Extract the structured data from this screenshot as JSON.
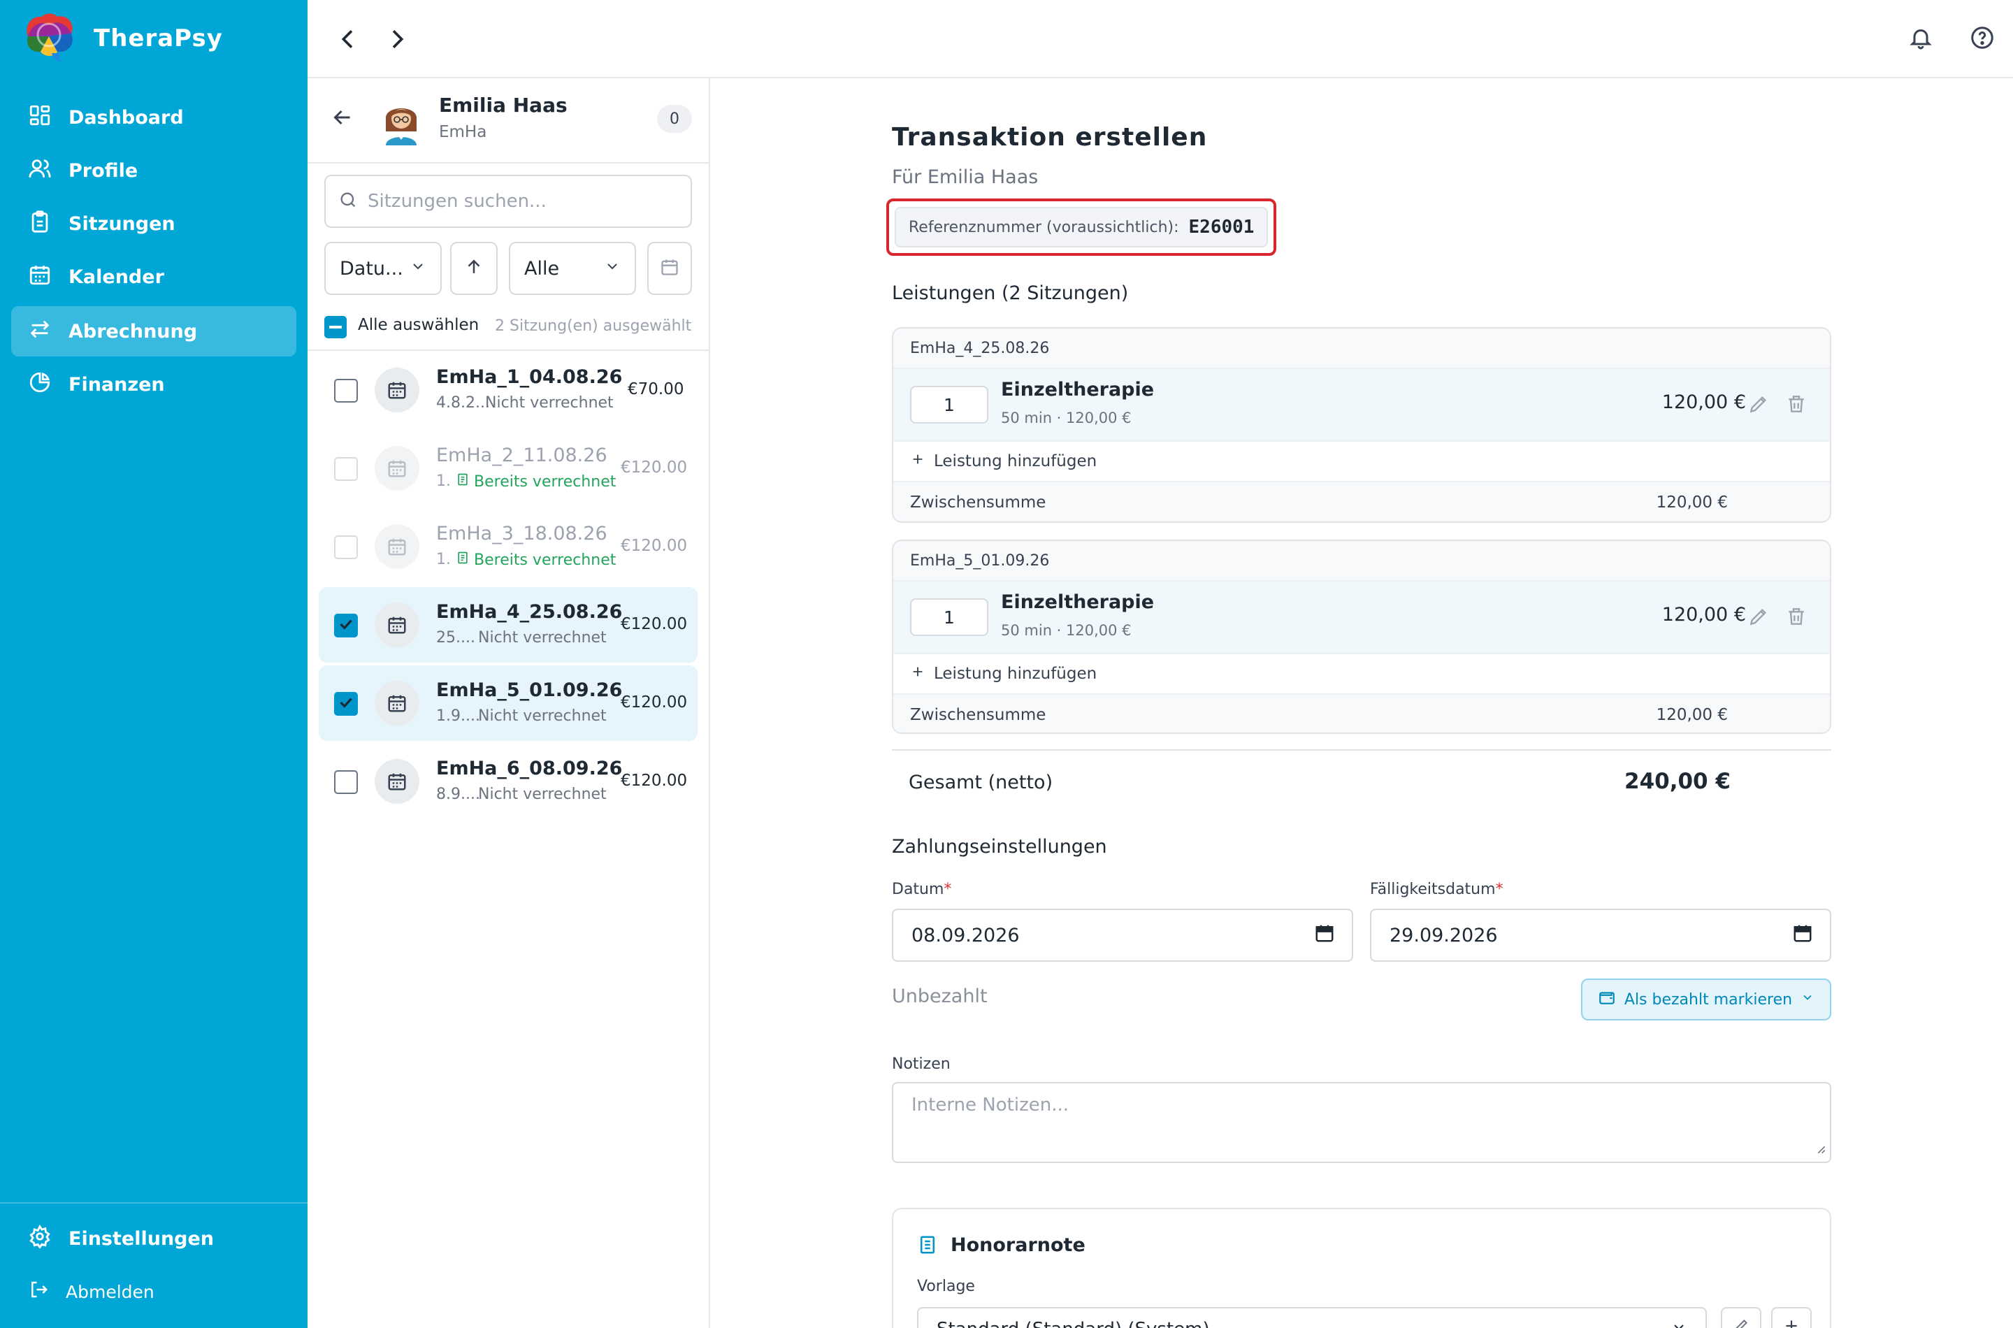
{
  "app": {
    "name": "TheraPsy"
  },
  "sidebar": {
    "items": [
      {
        "label": "Dashboard",
        "icon": "grid-icon"
      },
      {
        "label": "Profile",
        "icon": "users-icon"
      },
      {
        "label": "Sitzungen",
        "icon": "clipboard-icon"
      },
      {
        "label": "Kalender",
        "icon": "calendar-icon"
      },
      {
        "label": "Abrechnung",
        "icon": "arrows-exchange-icon",
        "active": true
      },
      {
        "label": "Finanzen",
        "icon": "pie-chart-icon"
      }
    ],
    "settings_label": "Einstellungen",
    "logout_label": "Abmelden"
  },
  "client": {
    "name": "Emilia Haas",
    "short": "EmHa",
    "count": "0"
  },
  "search": {
    "placeholder": "Sitzungen suchen..."
  },
  "filters": {
    "sort_label": "Datu...",
    "status_label": "Alle"
  },
  "selection": {
    "select_all_label": "Alle auswählen",
    "selected_count": "2 Sitzung(en) ausgewählt"
  },
  "sessions": [
    {
      "title": "EmHa_1_04.08.26",
      "date": "4.8.2...",
      "status": "Nicht verrechnet",
      "price": "€70.00",
      "state": "open"
    },
    {
      "title": "EmHa_2_11.08.26",
      "date": "1.",
      "status": "Bereits verrechnet",
      "price": "€120.00",
      "state": "billed"
    },
    {
      "title": "EmHa_3_18.08.26",
      "date": "1.",
      "status": "Bereits verrechnet",
      "price": "€120.00",
      "state": "billed"
    },
    {
      "title": "EmHa_4_25.08.26",
      "date": "25....",
      "status": "Nicht verrechnet",
      "price": "€120.00",
      "state": "selected"
    },
    {
      "title": "EmHa_5_01.09.26",
      "date": "1.9....",
      "status": "Nicht verrechnet",
      "price": "€120.00",
      "state": "selected"
    },
    {
      "title": "EmHa_6_08.09.26",
      "date": "8.9....",
      "status": "Nicht verrechnet",
      "price": "€120.00",
      "state": "open"
    }
  ],
  "main": {
    "title": "Transaktion erstellen",
    "subtitle": "Für Emilia Haas",
    "reference_label": "Referenznummer (voraussichtlich):",
    "reference_value": "E26001",
    "services_heading": "Leistungen (2 Sitzungen)",
    "groups": [
      {
        "session": "EmHa_4_25.08.26",
        "qty": "1",
        "service": "Einzeltherapie",
        "detail": "50 min · 120,00 €",
        "amount": "120,00 €",
        "add_label": "Leistung hinzufügen",
        "subtotal_label": "Zwischensumme",
        "subtotal": "120,00 €"
      },
      {
        "session": "EmHa_5_01.09.26",
        "qty": "1",
        "service": "Einzeltherapie",
        "detail": "50 min · 120,00 €",
        "amount": "120,00 €",
        "add_label": "Leistung hinzufügen",
        "subtotal_label": "Zwischensumme",
        "subtotal": "120,00 €"
      }
    ],
    "total_label": "Gesamt (netto)",
    "total_value": "240,00 €",
    "payment_heading": "Zahlungseinstellungen",
    "date_label": "Datum",
    "date_value": "08.09.2026",
    "due_label": "Fälligkeitsdatum",
    "due_value": "29.09.2026",
    "payment_status": "Unbezahlt",
    "mark_paid_label": "Als bezahlt markieren",
    "notes_label": "Notizen",
    "notes_placeholder": "Interne Notizen...",
    "invoice_title": "Honorarnote",
    "template_label": "Vorlage",
    "template_value": "Standard (Standard) (System)"
  },
  "colors": {
    "brand": "#00a6d6",
    "accent": "#0096cc",
    "highlight": "#d9262c",
    "success": "#22a55b"
  }
}
